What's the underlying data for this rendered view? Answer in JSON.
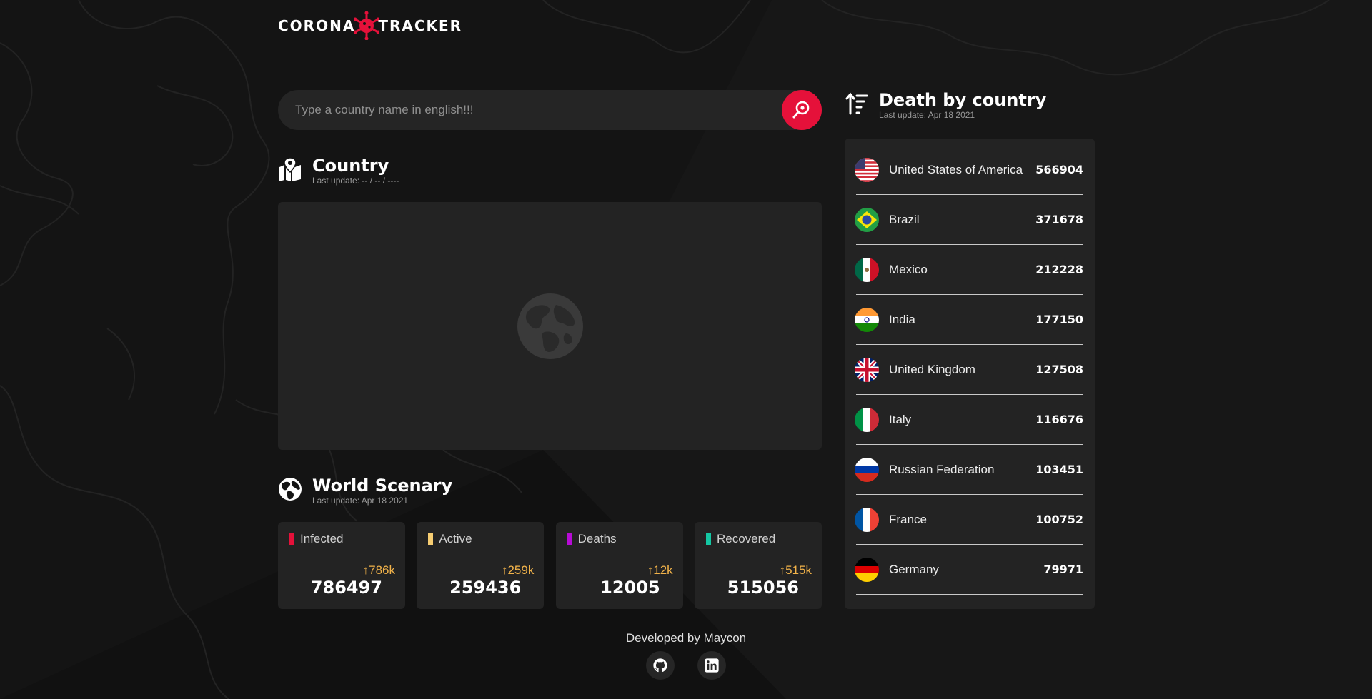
{
  "logo": {
    "left": "CORONA",
    "right": "TRACKER"
  },
  "search": {
    "placeholder": "Type a country name in english!!!"
  },
  "country_section": {
    "title": "Country",
    "subtitle": "Last update: -- / -- / ----"
  },
  "world_section": {
    "title": "World Scenary",
    "subtitle": "Last update: Apr 18 2021"
  },
  "cards": [
    {
      "label": "Infected",
      "delta": "↑786k",
      "value": "786497",
      "color": "#e5113a"
    },
    {
      "label": "Active",
      "delta": "↑259k",
      "value": "259436",
      "color": "#f6cd72"
    },
    {
      "label": "Deaths",
      "delta": "↑12k",
      "value": "12005",
      "color": "#b70bd6"
    },
    {
      "label": "Recovered",
      "delta": "↑515k",
      "value": "515056",
      "color": "#14c7a3"
    }
  ],
  "death_section": {
    "title": "Death by country",
    "subtitle": "Last update: Apr 18 2021"
  },
  "deaths": [
    {
      "country": "United States of America",
      "value": "566904",
      "flag": "usa-flag-icon"
    },
    {
      "country": "Brazil",
      "value": "371678",
      "flag": "brazil-flag-icon"
    },
    {
      "country": "Mexico",
      "value": "212228",
      "flag": "mexico-flag-icon"
    },
    {
      "country": "India",
      "value": "177150",
      "flag": "india-flag-icon"
    },
    {
      "country": "United Kingdom",
      "value": "127508",
      "flag": "uk-flag-icon"
    },
    {
      "country": "Italy",
      "value": "116676",
      "flag": "italy-flag-icon"
    },
    {
      "country": "Russian Federation",
      "value": "103451",
      "flag": "russia-flag-icon"
    },
    {
      "country": "France",
      "value": "100752",
      "flag": "france-flag-icon"
    },
    {
      "country": "Germany",
      "value": "79971",
      "flag": "germany-flag-icon"
    }
  ],
  "footer": {
    "text": "Developed by Maycon"
  },
  "colors": {
    "accent": "#e5113a",
    "delta": "#f2b34a",
    "panel": "#232323",
    "background": "#141414"
  },
  "icons": [
    "virus-icon",
    "search-map-pin-icon",
    "map-icon",
    "globe-icon",
    "sort-desc-icon",
    "github-icon",
    "linkedin-icon"
  ]
}
